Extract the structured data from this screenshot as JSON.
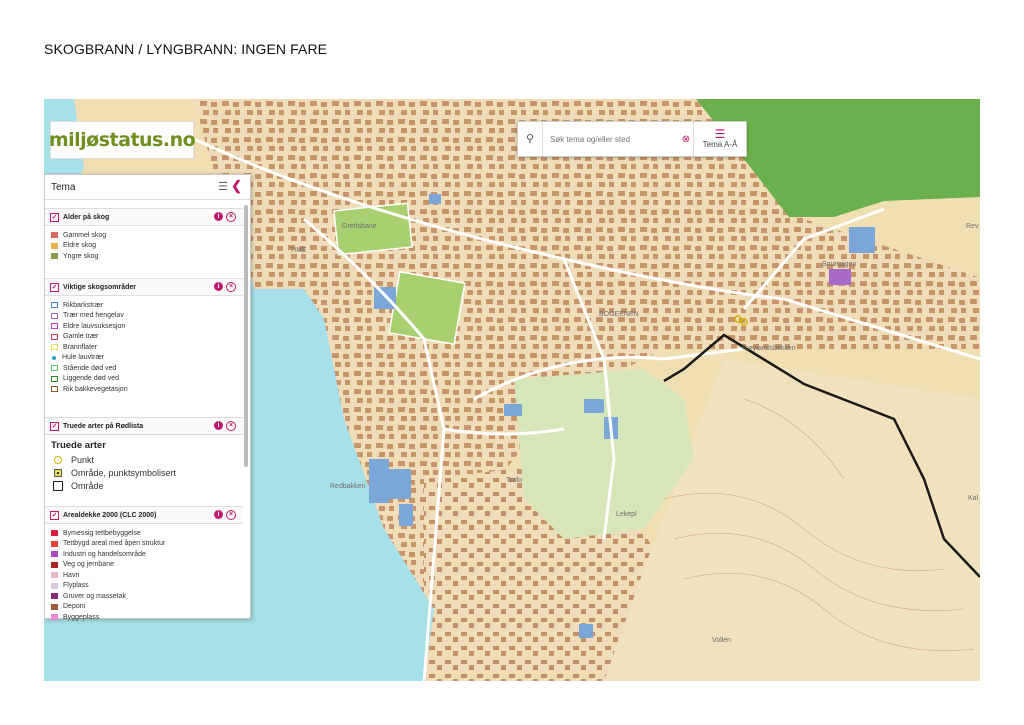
{
  "document": {
    "title": "SKOGBRANN / LYNGBRANN: INGEN FARE"
  },
  "app": {
    "logo": "miljøstatus.no"
  },
  "search": {
    "placeholder": "Søk tema og/eller sted",
    "tema_button": "Tema A-Å"
  },
  "panel": {
    "title": "Tema",
    "sections": [
      {
        "title": "Alder på skog",
        "items": [
          {
            "label": "Gammel skog",
            "color": "#d86a5e",
            "style": "fill"
          },
          {
            "label": "Eldre skog",
            "color": "#e8b04f",
            "style": "fill"
          },
          {
            "label": "Yngre skog",
            "color": "#8c9a4b",
            "style": "fill"
          }
        ]
      },
      {
        "title": "Viktige skogsområder",
        "items": [
          {
            "label": "Rikbarkstrær",
            "color": "#4a7fc1",
            "style": "outline"
          },
          {
            "label": "Trær med hengelav",
            "color": "#9a64c8",
            "style": "outline"
          },
          {
            "label": "Eldre lauvsuksesjon",
            "color": "#c43cc0",
            "style": "outline"
          },
          {
            "label": "Gamle trær",
            "color": "#c83c5a",
            "style": "outline"
          },
          {
            "label": "Brannflater",
            "color": "#e8e05a",
            "style": "outline"
          },
          {
            "label": "Hule lauvtrær",
            "color": "#2aa0c8",
            "style": "dot"
          },
          {
            "label": "Stående død ved",
            "color": "#5ac86a",
            "style": "outline"
          },
          {
            "label": "Liggende død ved",
            "color": "#2a8a2a",
            "style": "outline"
          },
          {
            "label": "Rik bakkevegetasjon",
            "color": "#8a5a2a",
            "style": "outline"
          }
        ]
      },
      {
        "title": "Truede arter på Rødlista",
        "subtitle": "Truede arter",
        "items": [
          {
            "label": "Punkt",
            "marker": "circle"
          },
          {
            "label": "Område, punktsymbolisert",
            "marker": "dotsquare"
          },
          {
            "label": "Område",
            "marker": "square"
          }
        ]
      },
      {
        "title": "Arealdekke 2000 (CLC 2000)",
        "items": [
          {
            "label": "Bymessig tettbebyggelse",
            "color": "#d81e3a",
            "style": "fill"
          },
          {
            "label": "Tettbygd areal med åpen struktur",
            "color": "#e8403c",
            "style": "fill"
          },
          {
            "label": "Industri og handelsområde",
            "color": "#b04ac8",
            "style": "fill"
          },
          {
            "label": "Veg og jernbane",
            "color": "#a82020",
            "style": "fill"
          },
          {
            "label": "Havn",
            "color": "#e8b8c8",
            "style": "fill"
          },
          {
            "label": "Flyplass",
            "color": "#d8c8e0",
            "style": "fill"
          },
          {
            "label": "Gruver og massetak",
            "color": "#8a2a7a",
            "style": "fill"
          },
          {
            "label": "Deponi",
            "color": "#a05a3a",
            "style": "fill"
          },
          {
            "label": "Byggeplass",
            "color": "#f08ad8",
            "style": "fill"
          }
        ]
      }
    ]
  },
  "map_labels": {
    "time": "TIME",
    "frelandsbekken": "Frøylandsbekken",
    "bogeenen": "BOGEENEN",
    "trafo": "Trafo",
    "lekeplass": "Lekepl",
    "vollen": "Vollen",
    "rev": "Rev",
    "kal": "Kal",
    "smorpigen": "Smørpigen",
    "grettsbane": "Grettsbane",
    "redbakken": "Redbakken"
  },
  "colors": {
    "accent": "#c0186c",
    "water": "#a6e0e8",
    "forest": "#6ab04c",
    "residential": "#efdcb4",
    "building": "#c8956a"
  }
}
